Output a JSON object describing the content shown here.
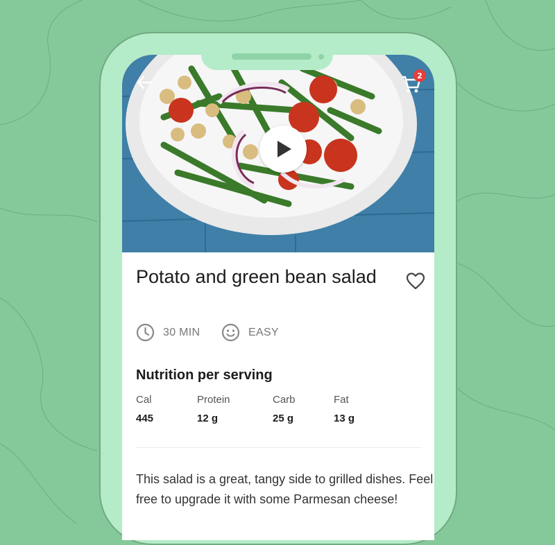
{
  "recipe": {
    "title": "Potato and green bean salad",
    "time": "30 MIN",
    "difficulty": "EASY",
    "description": "This salad is a great, tangy side to grilled dishes. Feel free to upgrade it with some Parmesan cheese!"
  },
  "cart": {
    "count": "2"
  },
  "nutrition": {
    "heading": "Nutrition per serving",
    "items": [
      {
        "label": "Cal",
        "value": "445"
      },
      {
        "label": "Protein",
        "value": "12 g"
      },
      {
        "label": "Carb",
        "value": "25 g"
      },
      {
        "label": "Fat",
        "value": "13 g"
      }
    ]
  },
  "icons": [
    "back-arrow-icon",
    "cart-icon",
    "play-icon",
    "heart-icon",
    "clock-icon",
    "smiley-icon"
  ],
  "colors": {
    "background": "#85c99b",
    "phone": "#b4ebc8",
    "badge": "#e63f3a",
    "wood": "#3f7fa8"
  }
}
